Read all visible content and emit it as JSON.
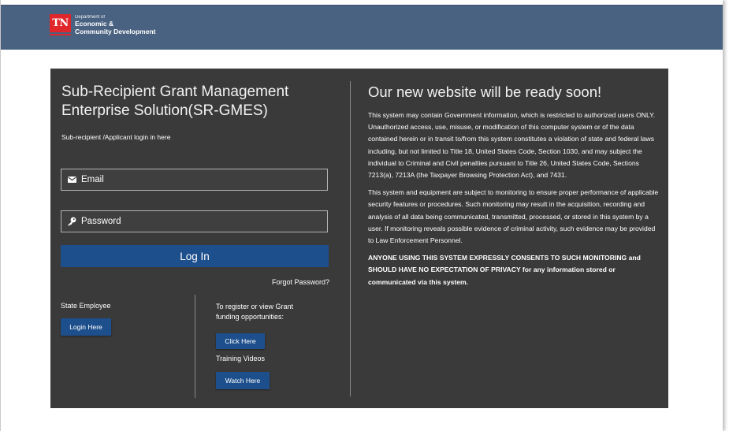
{
  "header": {
    "logo_badge": "TN",
    "logo_line1": "Department of",
    "logo_line2": "Economic &",
    "logo_line3": "Community Development"
  },
  "login": {
    "title_line1": "Sub-Recipient Grant Management",
    "title_line2": "Enterprise Solution(SR-GMES)",
    "subtitle": "Sub-recipient /Applicant login in here",
    "email_placeholder": "Email",
    "password_placeholder": "Password",
    "login_button": "Log In",
    "forgot_password": "Forgot Password?",
    "state_employee_label": "State Employee",
    "state_login_button": "Login Here",
    "register_label": "To register or view Grant funding opportunities:",
    "register_button": "Click Here",
    "training_label": "Training Videos",
    "training_button": "Watch Here"
  },
  "notice": {
    "title": "Our new website will be ready soon!",
    "paragraph1": "This system may contain Government information, which is restricted to authorized users ONLY. Unauthorized access, use, misuse, or modification of this computer system or of the data contained herein or in transit to/from this system constitutes a violation of state and federal laws including, but not limited to Title 18, United States Code, Section 1030, and may subject the individual to Criminal and Civil penalties pursuant to Title 26, United States Code, Sections 7213(a), 7213A (the Taxpayer Browsing Protection Act), and 7431.",
    "paragraph2": "This system and equipment are subject to monitoring to ensure proper performance of applicable security features or procedures. Such monitoring may result in the acquisition, recording and analysis of all data being communicated, transmitted, processed, or stored in this system by a user. If monitoring reveals possible evidence of criminal activity, such evidence may be provided to Law Enforcement Personnel.",
    "paragraph3": "ANYONE USING THIS SYSTEM EXPRESSLY CONSENTS TO SUCH MONITORING and SHOULD HAVE NO EXPECTATION OF PRIVACY for any information stored or communicated via this system."
  },
  "icons": {
    "email": "envelope-icon",
    "password": "key-icon"
  },
  "colors": {
    "header_bg": "#4a6281",
    "panel_bg": "#3a3a3a",
    "button_blue": "#1d4f8c",
    "logo_red": "#e0262b"
  }
}
